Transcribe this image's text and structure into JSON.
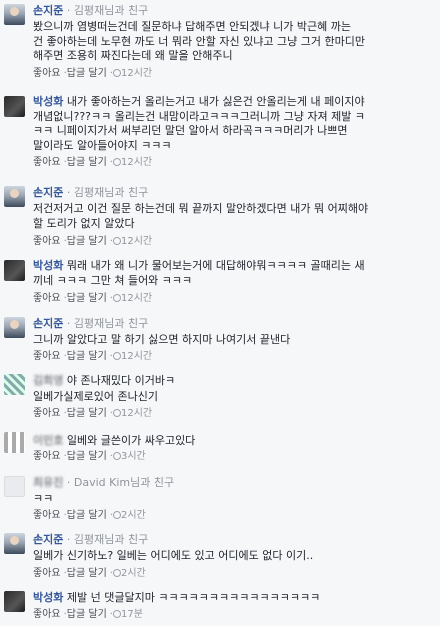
{
  "comments": [
    {
      "name": "손지준",
      "friend": "· 김평재님과 친구",
      "text": "봤으니까 염병떠는건데 질문하냐 답해주면 안되겠냐 니가 박근혜 까는\n건 좋아하는데 노무현 까도 너 뭐라 안할 자신 있냐고 그냥 그거 한마디만\n해주면 조용히 짜진다는데 왜 말을 안해주니",
      "like": "좋아요",
      "reply": "답글 달기",
      "time": "12시간"
    },
    {
      "name": "박성화",
      "friend": "",
      "text": "내가 좋아하는거 올리는거고 내가 싫은건 안올리는게 내 페이지야\n개념없니???ㅋㅋ 올리는건 내맘이라고ㅋㅋㅋ그러니까 그냥 자져 제발 ㅋ\nㅋㅋ 니페이지가서 써부리던 말던 알아서 하라곡ㅋㅋㅋ머리가 나쁘면\n말이라도 알아들어야지 ㅋㅋㅋ",
      "like": "좋아요",
      "reply": "답글 달기",
      "time": "12시간"
    },
    {
      "name": "손지준",
      "friend": "· 김평재님과 친구",
      "text": "저건저거고 이건 질문 하는건데 뭐 끝까지 말안하겠다면 내가 뭐 어찌해야\n할 도리가 없지 알았다",
      "like": "좋아요",
      "reply": "답글 달기",
      "time": "12시간"
    },
    {
      "name": "박성화",
      "friend": "",
      "text": "뭐래 내가 왜 니가 물어보는거에 대답해야뭐ㅋㅋㅋㅋ 골때리는 새\n끼네 ㅋㅋㅋ 그만 쳐 들어와 ㅋㅋㅋ",
      "like": "좋아요",
      "reply": "답글 달기",
      "time": "12시간"
    },
    {
      "name": "손지준",
      "friend": "· 김평재님과 친구",
      "text": "그니까 알았다고 말 하기 싫으면 하지마 나여기서 끝낸다",
      "like": "좋아요",
      "reply": "답글 달기",
      "time": "12시간"
    },
    {
      "name": "김희영",
      "friend": "",
      "text": "일베가실제로있어 존나신기",
      "inline": "야 존나재밌다 이거바ㅋ",
      "like": "좋아요",
      "reply": "답글 달기",
      "time": "12시간"
    },
    {
      "name": "이민호",
      "friend": "",
      "inline": "일베와 글쓴이가 싸우고있다",
      "like": "좋아요",
      "reply": "답글 달기",
      "time": "3시간"
    },
    {
      "name": "최유진",
      "friend": "· David Kim님과 친구",
      "text": "ㅋㅋ",
      "like": "좋아요",
      "reply": "답글 달기",
      "time": "2시간"
    },
    {
      "name": "손지준",
      "friend": "· 김평재님과 친구",
      "text": "일베가 신기하노? 일베는 어디에도 있고 어디에도 없다 이기..",
      "like": "좋아요",
      "reply": "답글 달기",
      "time": "2시간"
    },
    {
      "name": "박성화",
      "friend": "",
      "inline": "제발 넌 댓글달지마 ㅋㅋㅋㅋㅋㅋㅋㅋㅋㅋㅋㅋㅋㅋㅋㅋ",
      "like": "좋아요",
      "reply": "답글 달기",
      "time": "17분"
    }
  ]
}
